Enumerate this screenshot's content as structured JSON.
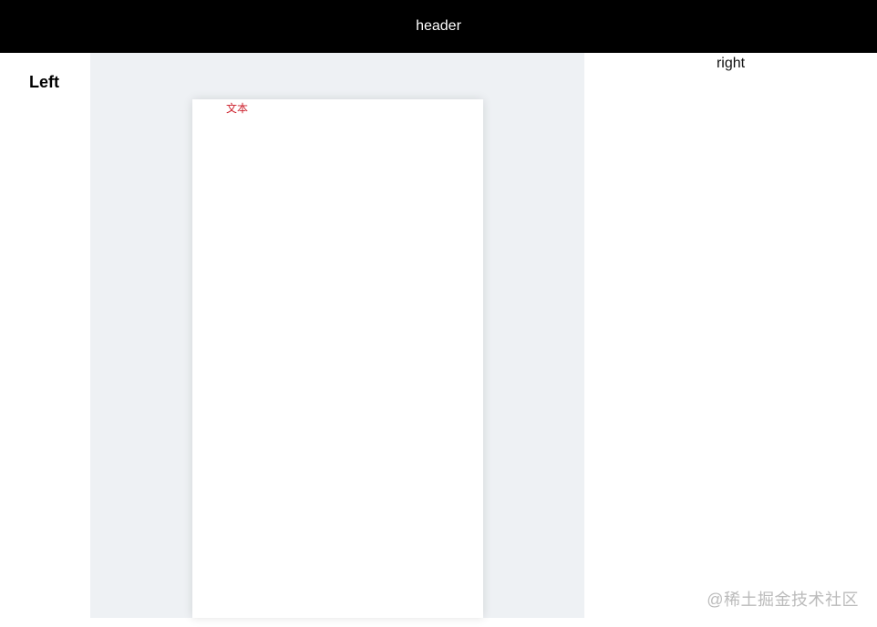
{
  "header": {
    "title": "header"
  },
  "left": {
    "title": "Left"
  },
  "canvas": {
    "text_element": "文本"
  },
  "right": {
    "title": "right"
  },
  "watermark": {
    "text": "@稀土掘金技术社区"
  },
  "colors": {
    "header_bg": "#000000",
    "canvas_bg": "#eef1f4",
    "text_element": "#cc1f2b"
  }
}
